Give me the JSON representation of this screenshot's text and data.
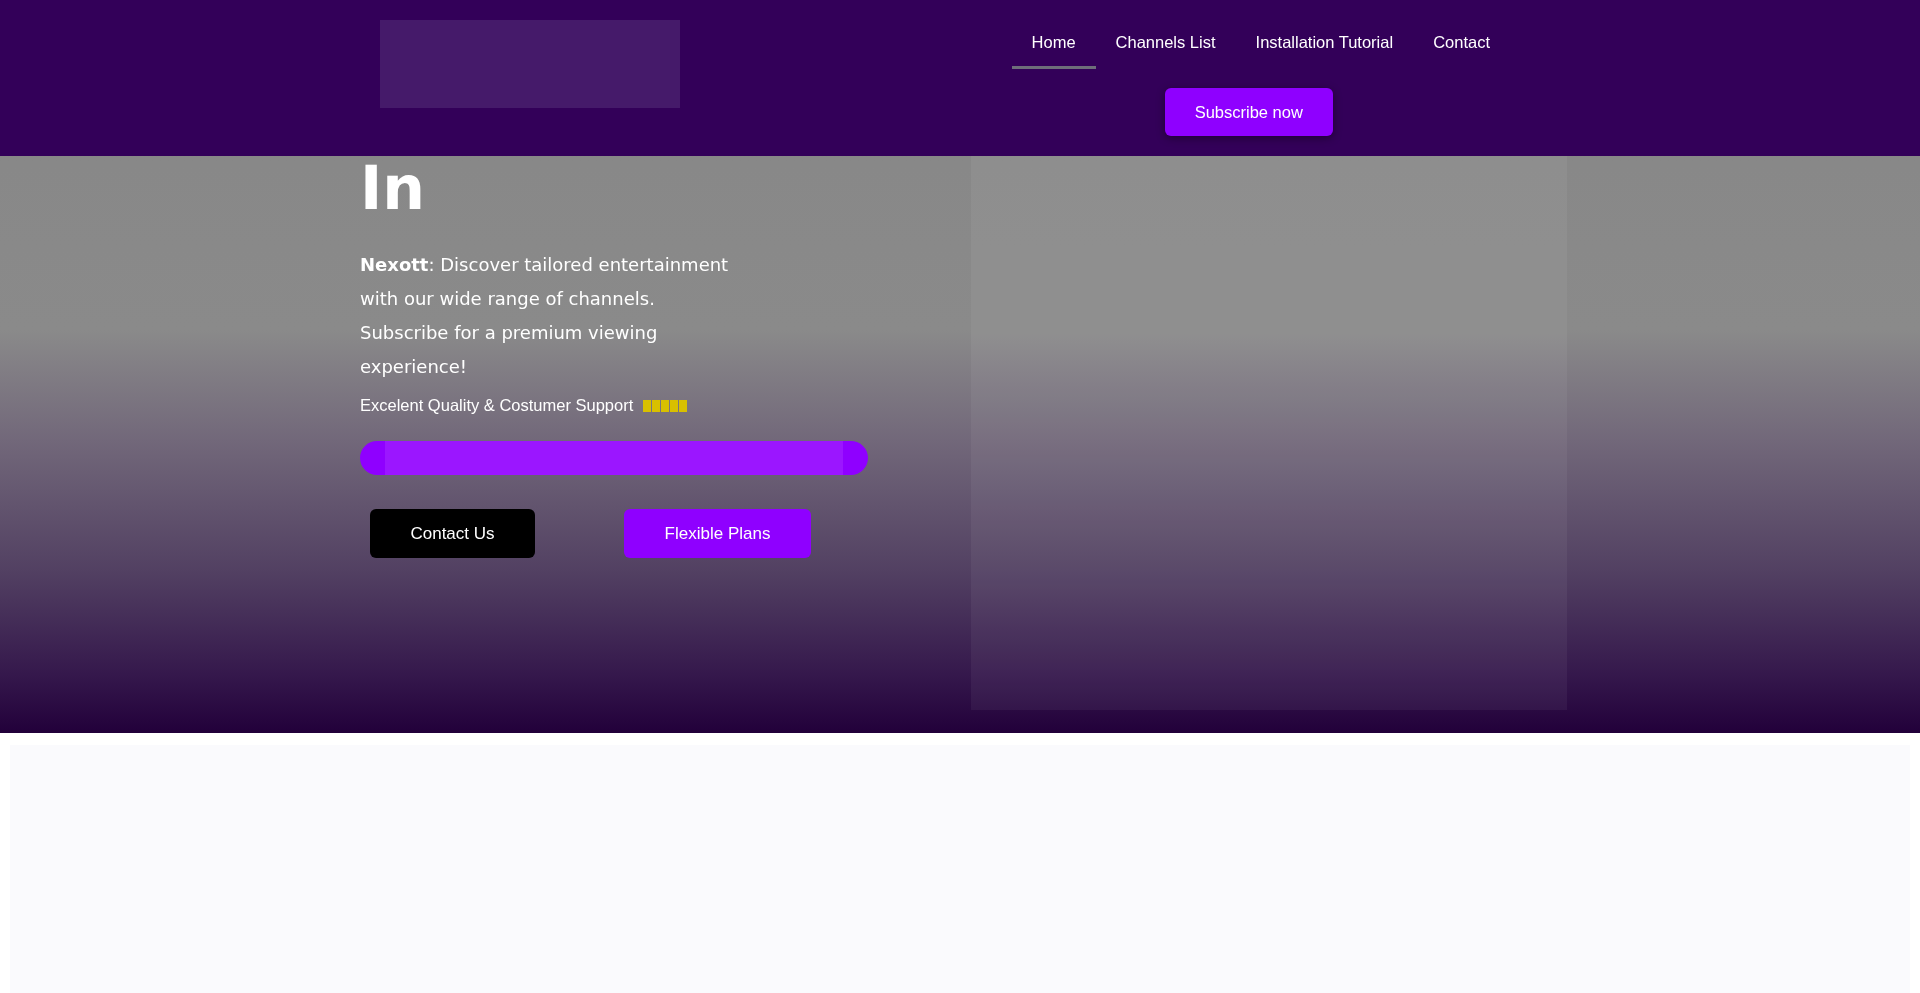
{
  "header": {
    "nav": [
      {
        "label": "Home",
        "selected": true
      },
      {
        "label": "Channels List",
        "selected": false
      },
      {
        "label": "Installation Tutorial",
        "selected": false
      },
      {
        "label": "Contact",
        "selected": false
      }
    ],
    "subscribe_button": "Subscribe now"
  },
  "hero": {
    "heading": "In",
    "intro": "**Nexott**: Discover tailored entertainment with our wide range of channels. Subscribe for a premium viewing experience!",
    "rating": {
      "label": "Excelent Quality & Costumer Support",
      "stars": 5
    },
    "buttons": [
      {
        "label": "Contact Us",
        "kind": "dark"
      },
      {
        "label": "Flexible Plans",
        "kind": "accent"
      }
    ]
  }
}
